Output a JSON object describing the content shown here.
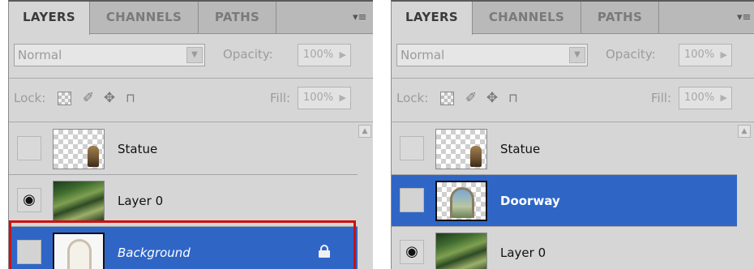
{
  "panels": [
    {
      "tabs": [
        {
          "label": "LAYERS",
          "active": true
        },
        {
          "label": "CHANNELS",
          "active": false
        },
        {
          "label": "PATHS",
          "active": false
        }
      ],
      "menu_icon": "panel-menu-icon",
      "blend_mode": "Normal",
      "opacity_label": "Opacity:",
      "opacity_value": "100%",
      "lock_label": "Lock:",
      "fill_label": "Fill:",
      "fill_value": "100%",
      "layers": [
        {
          "name": "Statue",
          "visible": false,
          "selected": false,
          "thumb": "statue"
        },
        {
          "name": "Layer 0",
          "visible": true,
          "selected": false,
          "thumb": "landscape"
        },
        {
          "name": "Background",
          "visible": false,
          "selected": true,
          "thumb": "doorway-white",
          "locked": true,
          "highlight_color": "#cc1111"
        }
      ]
    },
    {
      "tabs": [
        {
          "label": "LAYERS",
          "active": true
        },
        {
          "label": "CHANNELS",
          "active": false
        },
        {
          "label": "PATHS",
          "active": false
        }
      ],
      "menu_icon": "panel-menu-icon",
      "blend_mode": "Normal",
      "opacity_label": "Opacity:",
      "opacity_value": "100%",
      "lock_label": "Lock:",
      "fill_label": "Fill:",
      "fill_value": "100%",
      "layers": [
        {
          "name": "Statue",
          "visible": false,
          "selected": false,
          "thumb": "statue"
        },
        {
          "name": "Doorway",
          "visible": false,
          "selected": true,
          "thumb": "doorway-color"
        },
        {
          "name": "Layer 0",
          "visible": true,
          "selected": false,
          "thumb": "landscape"
        }
      ]
    }
  ],
  "colors": {
    "selection": "#2f66c6",
    "panel_bg": "#d6d6d6",
    "tabbar_bg": "#b9b9b9",
    "highlight_frame": "#cc1111"
  }
}
